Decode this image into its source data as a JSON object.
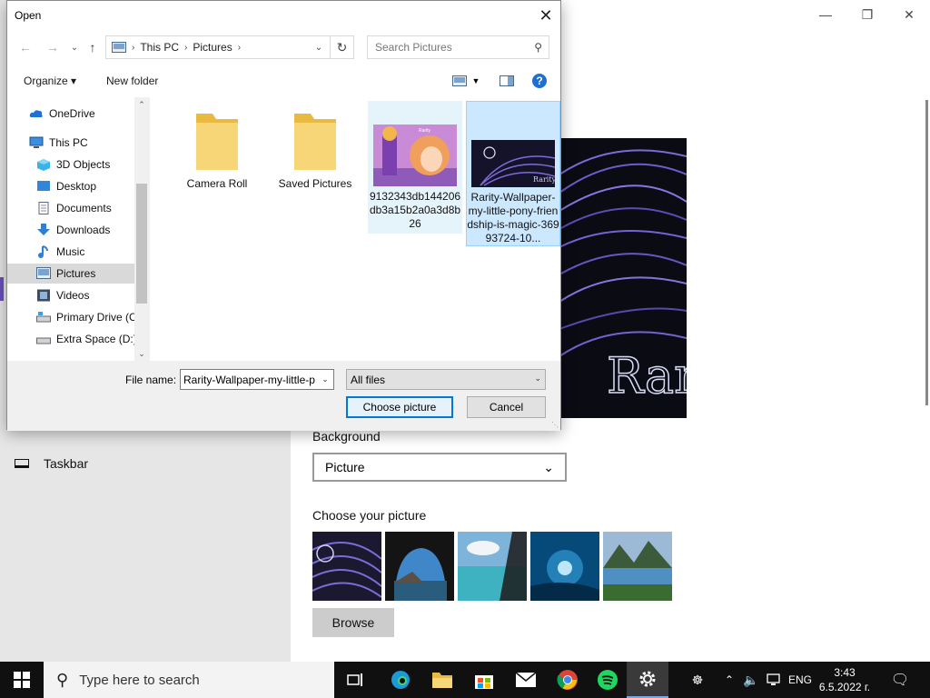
{
  "settings": {
    "sidebar_item": "Taskbar",
    "background_label": "Background",
    "background_value": "Picture",
    "choose_label": "Choose your picture",
    "browse_label": "Browse",
    "preview_text": "Rar",
    "thumbnails": [
      "rarity-thumb",
      "cave-window-thumb",
      "beach-thumb",
      "underwater-thumb",
      "mountain-lake-thumb"
    ]
  },
  "dialog": {
    "title": "Open",
    "address": {
      "items": [
        "This PC",
        "Pictures"
      ]
    },
    "search_placeholder": "Search Pictures",
    "organize_label": "Organize",
    "new_folder_label": "New folder",
    "tree": [
      {
        "label": "OneDrive",
        "icon": "onedrive-icon"
      },
      {
        "label": "This PC",
        "icon": "this-pc-icon"
      },
      {
        "label": "3D Objects",
        "icon": "3d-objects-icon"
      },
      {
        "label": "Desktop",
        "icon": "desktop-icon"
      },
      {
        "label": "Documents",
        "icon": "documents-icon"
      },
      {
        "label": "Downloads",
        "icon": "downloads-icon"
      },
      {
        "label": "Music",
        "icon": "music-icon"
      },
      {
        "label": "Pictures",
        "icon": "pictures-icon"
      },
      {
        "label": "Videos",
        "icon": "videos-icon"
      },
      {
        "label": "Primary Drive (C",
        "icon": "drive-c-icon"
      },
      {
        "label": "Extra Space (D:)",
        "icon": "drive-d-icon"
      }
    ],
    "files": [
      {
        "label": "Camera Roll"
      },
      {
        "label": "Saved Pictures"
      },
      {
        "label": "9132343db144206db3a15b2a0a3d8b26"
      },
      {
        "label": "Rarity-Wallpaper-my-little-pony-friendship-is-magic-36993724-10..."
      }
    ],
    "file_name_label": "File name:",
    "file_name_value": "Rarity-Wallpaper-my-little-p",
    "file_type_value": "All files",
    "choose_button": "Choose picture",
    "cancel_button": "Cancel",
    "image_thumb_1_text": "Rarity",
    "image_thumb_2_text": "Rarity"
  },
  "taskbar": {
    "search_placeholder": "Type here to search",
    "language": "ENG",
    "time": "3:43",
    "date": "6.5.2022 г."
  },
  "colors": {
    "accent": "#0078d7",
    "selection": "#cce8ff",
    "taskbar": "#101010",
    "folder": "#f3d272"
  }
}
